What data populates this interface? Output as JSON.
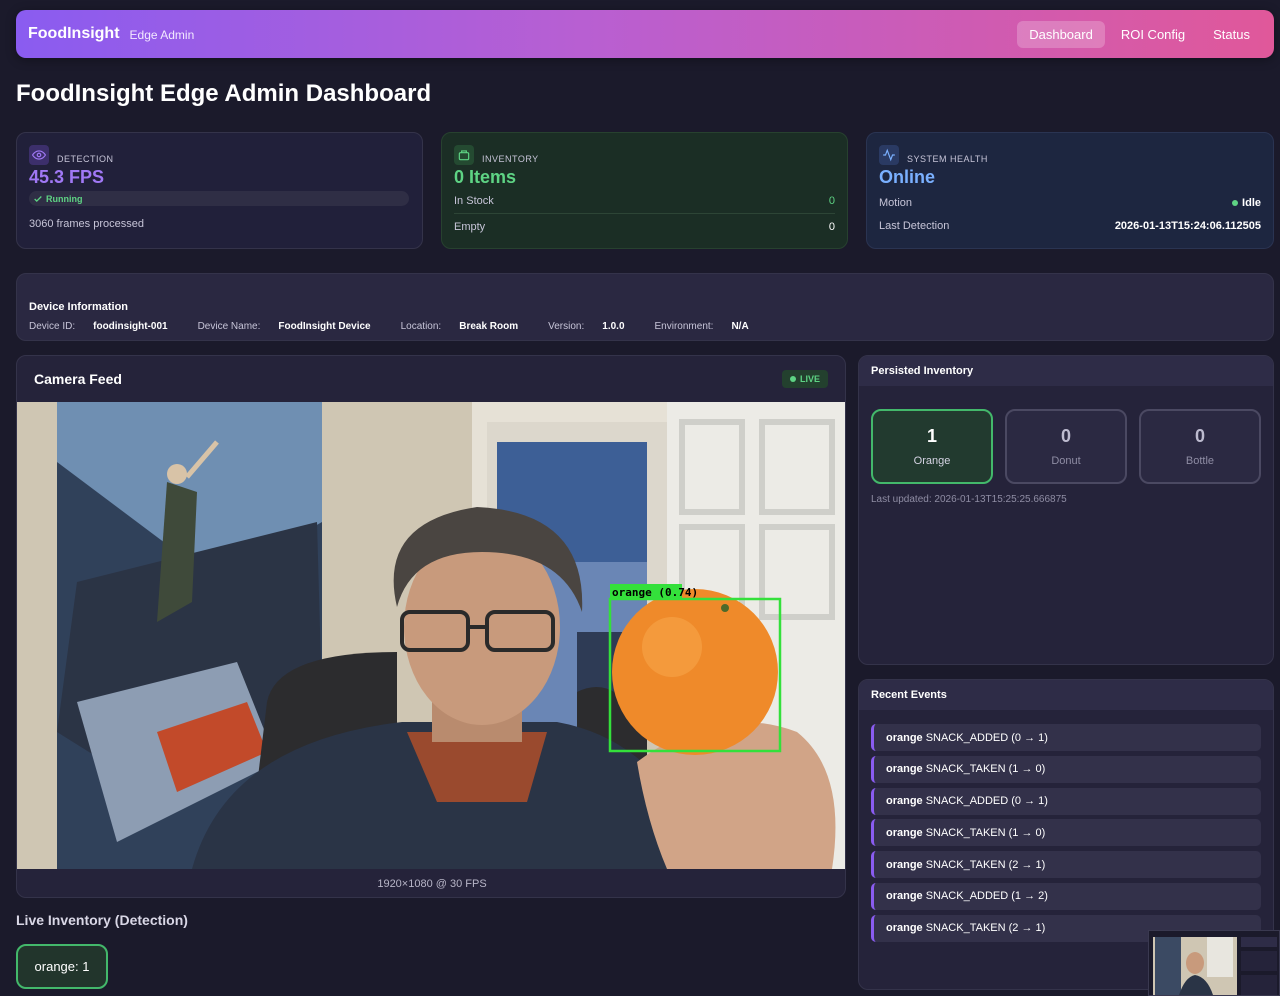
{
  "nav": {
    "brand": "FoodInsight",
    "subtitle": "Edge Admin",
    "links": [
      "Dashboard",
      "ROI Config",
      "Status"
    ]
  },
  "page": {
    "title": "FoodInsight Edge Admin Dashboard"
  },
  "detection": {
    "label": "DETECTION",
    "value": "45.3 FPS",
    "status": "Running",
    "frames": "3060 frames processed"
  },
  "inventory": {
    "label": "INVENTORY",
    "value": "0 Items",
    "rows": [
      {
        "key": "In Stock",
        "value": "0"
      },
      {
        "key": "Empty",
        "value": "0"
      }
    ]
  },
  "health": {
    "label": "SYSTEM HEALTH",
    "value": "Online",
    "motion_key": "Motion",
    "motion_value": "Idle",
    "last_key": "Last Detection",
    "last_value": "2026-01-13T15:24:06.112505"
  },
  "device": {
    "title": "Device Information",
    "fields": [
      {
        "key": "Device ID:",
        "value": "foodinsight-001"
      },
      {
        "key": "Device Name:",
        "value": "FoodInsight Device"
      },
      {
        "key": "Location:",
        "value": "Break Room"
      },
      {
        "key": "Version:",
        "value": "1.0.0"
      },
      {
        "key": "Environment:",
        "value": "N/A"
      }
    ]
  },
  "camera": {
    "title": "Camera Feed",
    "badge": "LIVE",
    "detection_label": "orange (0.74)",
    "footer": "1920×1080 @ 30 FPS"
  },
  "live_inventory": {
    "title": "Live Inventory (Detection)",
    "chip": "orange: 1"
  },
  "persisted": {
    "title": "Persisted Inventory",
    "tiles": [
      {
        "count": "1",
        "name": "Orange",
        "active": true
      },
      {
        "count": "0",
        "name": "Donut",
        "active": false
      },
      {
        "count": "0",
        "name": "Bottle",
        "active": false
      }
    ],
    "last_updated": "Last updated: 2026-01-13T15:25:25.666875"
  },
  "events": {
    "title": "Recent Events",
    "items": [
      {
        "item": "orange",
        "text": "SNACK_ADDED (0 → 1)"
      },
      {
        "item": "orange",
        "text": "SNACK_TAKEN (1 → 0)"
      },
      {
        "item": "orange",
        "text": "SNACK_ADDED (0 → 1)"
      },
      {
        "item": "orange",
        "text": "SNACK_TAKEN (1 → 0)"
      },
      {
        "item": "orange",
        "text": "SNACK_TAKEN (2 → 1)"
      },
      {
        "item": "orange",
        "text": "SNACK_ADDED (1 → 2)"
      },
      {
        "item": "orange",
        "text": "SNACK_TAKEN (2 → 1)"
      }
    ]
  },
  "colors": {
    "accent_purple": "#8a5cf0",
    "accent_pink": "#e0589a",
    "success_green": "#5ed384",
    "info_blue": "#7ab0ff"
  }
}
